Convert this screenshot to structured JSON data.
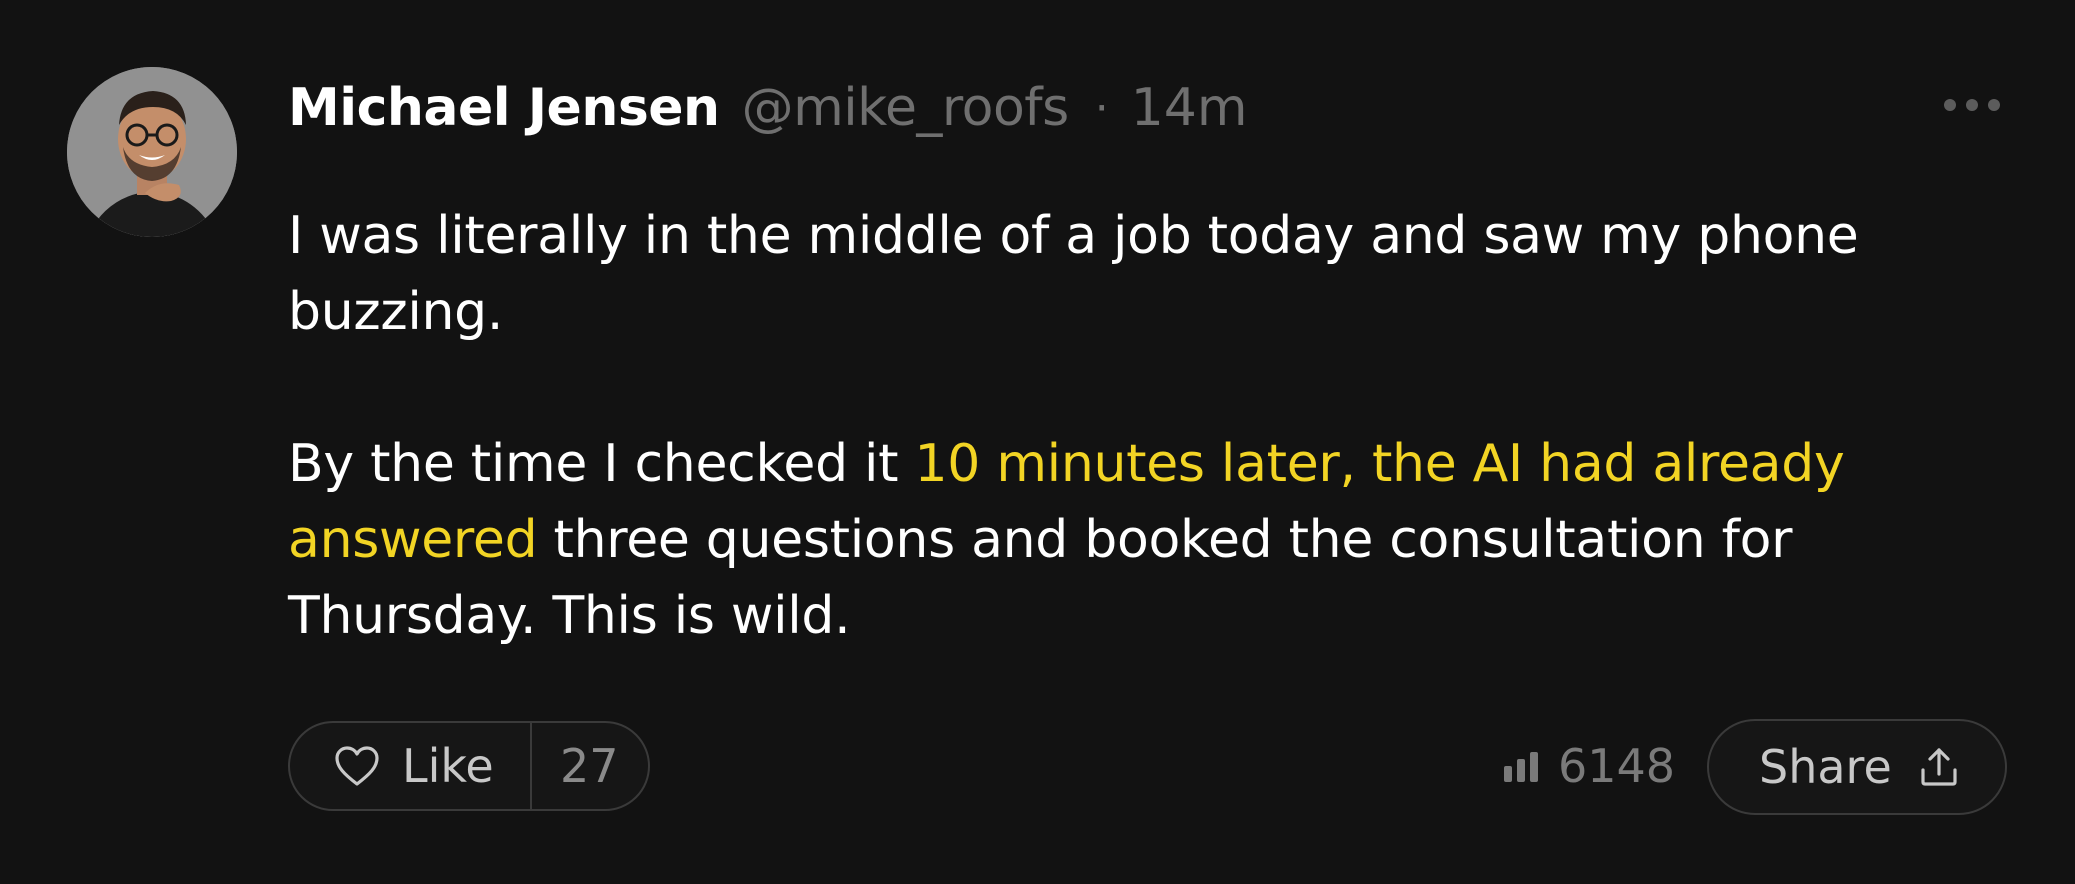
{
  "post": {
    "author_name": "Michael Jensen",
    "author_handle": "@mike_roofs",
    "separator": "·",
    "time_ago": "14m",
    "paragraph_1": "I was literally in the middle of a job today and saw my phone buzzing.",
    "paragraph_2_before": "By the time I checked it ",
    "paragraph_2_highlight": "10 minutes later, the AI had already answered",
    "paragraph_2_after": " three questions and booked the consultation for Thursday. This is wild.",
    "highlight_color": "#f2d424"
  },
  "actions": {
    "like_label": "Like",
    "like_count": "27",
    "views_count": "6148",
    "share_label": "Share"
  },
  "icons": {
    "avatar": "avatar",
    "more": "more-horizontal-icon",
    "like": "heart-icon",
    "views": "bar-chart-icon",
    "share": "share-upload-icon"
  }
}
